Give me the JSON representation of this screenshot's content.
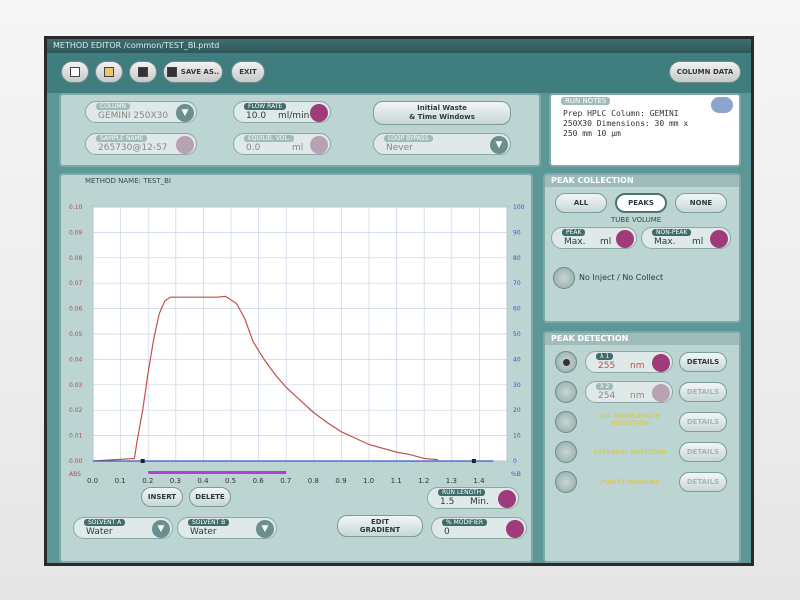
{
  "window": {
    "title": "METHOD EDITOR /common/TEST_BI.pmtd"
  },
  "toolbar": {
    "save_as": "SAVE AS..",
    "exit": "EXIT",
    "column_data": "COLUMN DATA"
  },
  "params": {
    "column_label": "COLUMN",
    "column_value": "GEMINI 250X30",
    "sample_label": "SAMPLE NAME",
    "sample_value": "265730@12-57",
    "flow_label": "FLOW RATE",
    "flow_value": "10.0",
    "flow_unit": "ml/min",
    "equil_label": "EQUILIB. VOL.",
    "equil_value": "0.0",
    "equil_unit": "ml",
    "waste_button": "Initial Waste\n& Time Windows",
    "loop_label": "LOOP BYPASS",
    "loop_value": "Never"
  },
  "run_notes": {
    "label": "RUN NOTES",
    "text": "Prep HPLC Column: GEMINI\n250X30 Dimensions: 30 mm x\n250 mm 10 µm"
  },
  "chart": {
    "method_name": "METHOD NAME: TEST_BI",
    "left_axis_unit": "ABS",
    "right_axis_unit": "%B",
    "left_ticks": [
      "0.10",
      "0.09",
      "0.08",
      "0.07",
      "0.06",
      "0.05",
      "0.04",
      "0.03",
      "0.02",
      "0.01",
      "0.00"
    ],
    "right_ticks": [
      "100",
      "90",
      "80",
      "70",
      "60",
      "50",
      "40",
      "30",
      "20",
      "10",
      "0"
    ],
    "x_ticks": [
      "0.0",
      "0.1",
      "0.2",
      "0.3",
      "0.4",
      "0.5",
      "0.6",
      "0.7",
      "0.8",
      "0.9",
      "1.0",
      "1.1",
      "1.2",
      "1.3",
      "1.4"
    ]
  },
  "chart_data": {
    "type": "line",
    "xlim": [
      0,
      1.5
    ],
    "ylim": [
      0,
      0.1
    ],
    "y2lim": [
      0,
      100
    ],
    "series": [
      {
        "color": "#c0504d",
        "x": [
          0,
          0.15,
          0.16,
          0.18,
          0.2,
          0.22,
          0.24,
          0.26,
          0.28,
          0.3,
          0.35,
          0.4,
          0.45,
          0.48,
          0.52,
          0.55,
          0.58,
          0.62,
          0.66,
          0.7,
          0.75,
          0.8,
          0.85,
          0.9,
          0.95,
          1.0,
          1.05,
          1.1,
          1.15,
          1.2,
          1.25
        ],
        "y": [
          0,
          0.001,
          0.008,
          0.02,
          0.035,
          0.048,
          0.058,
          0.063,
          0.0645,
          0.0645,
          0.0645,
          0.0645,
          0.0645,
          0.0648,
          0.062,
          0.056,
          0.047,
          0.04,
          0.034,
          0.029,
          0.024,
          0.019,
          0.015,
          0.0115,
          0.009,
          0.0065,
          0.005,
          0.0035,
          0.0025,
          0.001,
          0.0005
        ]
      },
      {
        "color": "#3a58c8",
        "x": [
          0,
          1.45
        ],
        "y2": [
          0,
          0
        ]
      }
    ],
    "collect_window": [
      0.2,
      0.7
    ],
    "markers": [
      0.18,
      1.38
    ]
  },
  "chart_controls": {
    "insert": "INSERT",
    "delete": "DELETE",
    "run_length_label": "RUN LENGTH",
    "run_length_value": "1.5",
    "run_length_unit": "Min.",
    "solvent_a_label": "SOLVENT A",
    "solvent_a_value": "Water",
    "solvent_b_label": "SOLVENT B",
    "solvent_b_value": "Water",
    "edit_gradient": "EDIT\nGRADIENT",
    "modifier_label": "% MODIFIER",
    "modifier_value": "0"
  },
  "peak_collection": {
    "title": "PEAK COLLECTION",
    "all": "ALL",
    "peaks": "PEAKS",
    "none": "NONE",
    "tube_volume": "TUBE VOLUME",
    "peak_label": "PEAK",
    "peak_value": "Max.",
    "peak_unit": "ml",
    "nonpeak_label": "NON-PEAK",
    "nonpeak_value": "Max.",
    "nonpeak_unit": "ml",
    "no_inject": "No Inject / No Collect"
  },
  "peak_detection": {
    "title": "PEAK DETECTION",
    "lambda1_label": "λ 1",
    "lambda1_value": "255",
    "lambda1_unit": "nm",
    "lambda2_label": "λ 2",
    "lambda2_value": "254",
    "lambda2_unit": "nm",
    "details": "DETAILS",
    "all_wavelength": "ALL WAVELENGTH\nDETECTION",
    "external": "EXTERNAL DETECTOR",
    "purity": "PURITY MEASURE"
  }
}
